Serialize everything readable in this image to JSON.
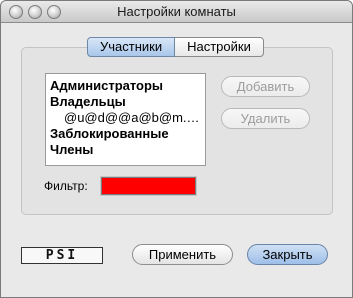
{
  "window": {
    "title": "Настройки комнаты"
  },
  "tabs": [
    {
      "label": "Участники",
      "active": true
    },
    {
      "label": "Настройки",
      "active": false
    }
  ],
  "list": {
    "items": [
      {
        "label": "Администраторы"
      },
      {
        "label": "Владельцы"
      },
      {
        "label": "@u@d@@a@b@m.c…"
      },
      {
        "label": "Заблокированные"
      },
      {
        "label": "Члены"
      }
    ]
  },
  "buttons": {
    "add": "Добавить",
    "remove": "Удалить",
    "apply": "Применить",
    "close": "Закрыть"
  },
  "filter": {
    "label": "Фильтр:",
    "value": ""
  },
  "logo": {
    "text": "PSI"
  },
  "colors": {
    "filter_field": "#ff0000",
    "active_tab": "#a8c6ea",
    "window_bg": "#e9e9e9"
  }
}
